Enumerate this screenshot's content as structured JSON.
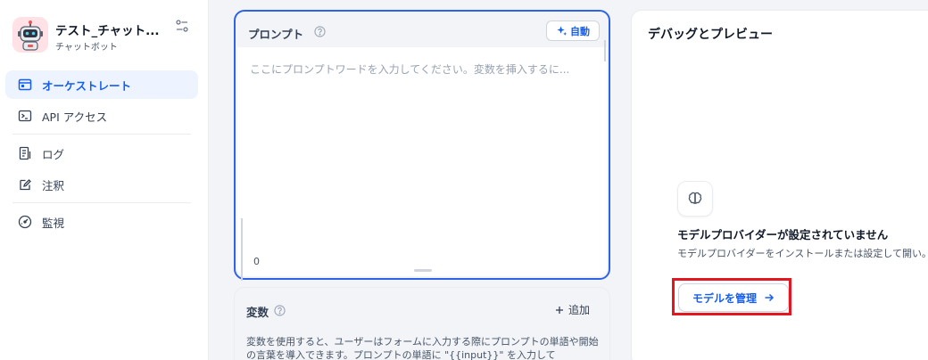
{
  "app": {
    "name": "テスト_チャット...",
    "type": "チャットボット"
  },
  "sidebar": {
    "items": [
      {
        "label": "オーケストレート",
        "icon": "orchestrate-icon",
        "active": true
      },
      {
        "label": "API アクセス",
        "icon": "terminal-icon",
        "active": false
      },
      {
        "label": "ログ",
        "icon": "log-icon",
        "active": false
      },
      {
        "label": "注釈",
        "icon": "annotation-icon",
        "active": false
      },
      {
        "label": "監視",
        "icon": "gauge-icon",
        "active": false
      }
    ]
  },
  "prompt": {
    "label": "プロンプト",
    "auto_label": "自動",
    "placeholder": "ここにプロンプトワードを入力してください。変数を挿入するに...",
    "char_count": "0"
  },
  "variables": {
    "label": "変数",
    "add_label": "追加",
    "description": "変数を使用すると、ユーザーはフォームに入力する際にプロンプトの単語や開始の言葉を導入できます。プロンプトの単語に \"{{input}}\" を入力して"
  },
  "debug": {
    "title": "デバッグとプレビュー",
    "no_provider_title": "モデルプロバイダーが設定されていません",
    "no_provider_desc": "モデルプロバイダーをインストールまたは設定して開い。",
    "manage_label": "モデルを管理"
  },
  "colors": {
    "accent": "#155eef",
    "highlight": "#e4161f",
    "active_bg": "#eef4ff"
  }
}
